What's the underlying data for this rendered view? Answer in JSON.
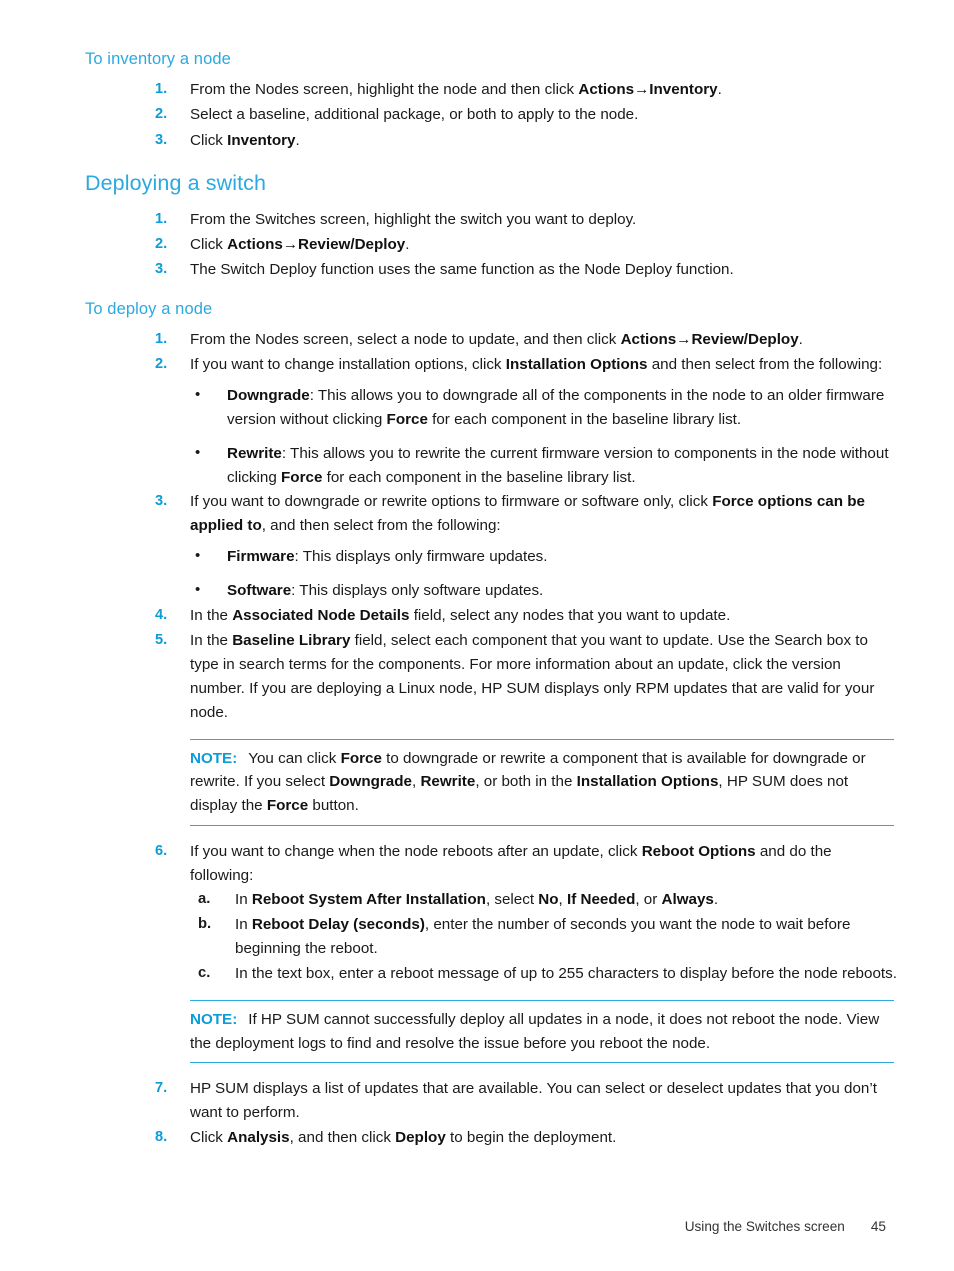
{
  "colors": {
    "heading_blue": "#2BA9E0",
    "marker_blue": "#0C9CD8",
    "body_text": "#1a1a1a",
    "rule_blue": "#2BA9E0"
  },
  "sections": [
    {
      "id": "to-inventory-a-node",
      "level": "h2",
      "title": "To inventory a node",
      "steps": [
        {
          "marker": "1.",
          "parts": [
            {
              "t": "From the Nodes screen, highlight the node and then click "
            },
            {
              "t": "Actions",
              "b": true
            },
            {
              "t": "→",
              "b": true
            },
            {
              "t": "Inventory",
              "b": true
            },
            {
              "t": "."
            }
          ]
        },
        {
          "marker": "2.",
          "parts": [
            {
              "t": "Select a baseline, additional package, or both to apply to the node."
            }
          ]
        },
        {
          "marker": "3.",
          "parts": [
            {
              "t": "Click "
            },
            {
              "t": "Inventory",
              "b": true
            },
            {
              "t": "."
            }
          ]
        }
      ]
    },
    {
      "id": "deploying-a-switch",
      "level": "h1",
      "title": "Deploying a switch",
      "steps": [
        {
          "marker": "1.",
          "parts": [
            {
              "t": "From the Switches screen, highlight the switch you want to deploy."
            }
          ]
        },
        {
          "marker": "2.",
          "parts": [
            {
              "t": "Click "
            },
            {
              "t": "Actions",
              "b": true
            },
            {
              "t": "→",
              "b": true
            },
            {
              "t": "Review/Deploy",
              "b": true
            },
            {
              "t": "."
            }
          ]
        },
        {
          "marker": "3.",
          "parts": [
            {
              "t": "The Switch Deploy function uses the same function as the Node Deploy function."
            }
          ]
        }
      ]
    },
    {
      "id": "to-deploy-a-node",
      "level": "h2",
      "title": "To deploy a node",
      "steps": [
        {
          "marker": "1.",
          "parts": [
            {
              "t": "From the Nodes screen, select a node to update, and then click "
            },
            {
              "t": "Actions",
              "b": true
            },
            {
              "t": "→",
              "b": true
            },
            {
              "t": "Review/Deploy",
              "b": true
            },
            {
              "t": "."
            }
          ]
        },
        {
          "marker": "2.",
          "parts": [
            {
              "t": "If you want to change installation options, click "
            },
            {
              "t": "Installation Options",
              "b": true
            },
            {
              "t": " and then select from the following:"
            }
          ],
          "bullets": [
            {
              "parts": [
                {
                  "t": "Downgrade",
                  "b": true
                },
                {
                  "t": ": This allows you to downgrade all of the components in the node to an older firmware version without clicking "
                },
                {
                  "t": "Force",
                  "b": true
                },
                {
                  "t": " for each component in the baseline library list."
                }
              ]
            },
            {
              "parts": [
                {
                  "t": "Rewrite",
                  "b": true
                },
                {
                  "t": ": This allows you to rewrite the current firmware version to components in the node without clicking "
                },
                {
                  "t": "Force",
                  "b": true
                },
                {
                  "t": " for each component in the baseline library list."
                }
              ]
            }
          ]
        },
        {
          "marker": "3.",
          "parts": [
            {
              "t": "If you want to downgrade or rewrite options to firmware or software only, click "
            },
            {
              "t": "Force options can be applied to",
              "b": true
            },
            {
              "t": ", and then select from the following:"
            }
          ],
          "bullets": [
            {
              "parts": [
                {
                  "t": "Firmware",
                  "b": true
                },
                {
                  "t": ": This displays only firmware updates."
                }
              ]
            },
            {
              "parts": [
                {
                  "t": "Software",
                  "b": true
                },
                {
                  "t": ": This displays only software updates."
                }
              ]
            }
          ]
        },
        {
          "marker": "4.",
          "parts": [
            {
              "t": "In the "
            },
            {
              "t": "Associated Node Details",
              "b": true
            },
            {
              "t": " field, select any nodes that you want to update."
            }
          ]
        },
        {
          "marker": "5.",
          "parts": [
            {
              "t": "In the "
            },
            {
              "t": "Baseline Library",
              "b": true
            },
            {
              "t": " field, select each component that you want to update. Use the Search box to type in search terms for the components. For more information about an update, click the version number. If you are deploying a Linux node, HP SUM displays only RPM updates that are valid for your node."
            }
          ],
          "note": {
            "label": "NOTE:",
            "parts": [
              {
                "t": "You can click "
              },
              {
                "t": "Force",
                "b": true
              },
              {
                "t": " to downgrade or rewrite a component that is available for downgrade or rewrite. If you select "
              },
              {
                "t": "Downgrade",
                "b": true
              },
              {
                "t": ", "
              },
              {
                "t": "Rewrite",
                "b": true
              },
              {
                "t": ", or both in the "
              },
              {
                "t": "Installation Options",
                "b": true
              },
              {
                "t": ", HP SUM does not display the "
              },
              {
                "t": "Force",
                "b": true
              },
              {
                "t": " button."
              }
            ]
          }
        },
        {
          "marker": "6.",
          "parts": [
            {
              "t": "If you want to change when the node reboots after an update, click "
            },
            {
              "t": "Reboot Options",
              "b": true
            },
            {
              "t": " and do the following:"
            }
          ],
          "alpha": [
            {
              "marker": "a.",
              "parts": [
                {
                  "t": "In "
                },
                {
                  "t": "Reboot System After Installation",
                  "b": true
                },
                {
                  "t": ", select "
                },
                {
                  "t": "No",
                  "b": true
                },
                {
                  "t": ", "
                },
                {
                  "t": "If Needed",
                  "b": true
                },
                {
                  "t": ", or "
                },
                {
                  "t": "Always",
                  "b": true
                },
                {
                  "t": "."
                }
              ]
            },
            {
              "marker": "b.",
              "parts": [
                {
                  "t": "In "
                },
                {
                  "t": "Reboot Delay (seconds)",
                  "b": true
                },
                {
                  "t": ", enter the number of seconds you want the node to wait before beginning the reboot."
                }
              ]
            },
            {
              "marker": "c.",
              "parts": [
                {
                  "t": "In the text box, enter a reboot message of up to 255 characters to display before the node reboots."
                }
              ]
            }
          ],
          "note": {
            "label": "NOTE:",
            "parts": [
              {
                "t": "If HP SUM cannot successfully deploy all updates in a node, it does not reboot the node. View the deployment logs to find and resolve the issue before you reboot the node."
              }
            ]
          }
        },
        {
          "marker": "7.",
          "parts": [
            {
              "t": "HP SUM displays a list of updates that are available. You can select or deselect updates that you don’t want to perform."
            }
          ]
        },
        {
          "marker": "8.",
          "parts": [
            {
              "t": "Click "
            },
            {
              "t": "Analysis",
              "b": true
            },
            {
              "t": ", and then click "
            },
            {
              "t": "Deploy",
              "b": true
            },
            {
              "t": " to begin the deployment."
            }
          ]
        }
      ]
    }
  ],
  "footer": {
    "running_head": "Using the Switches screen",
    "page_number": "45"
  }
}
